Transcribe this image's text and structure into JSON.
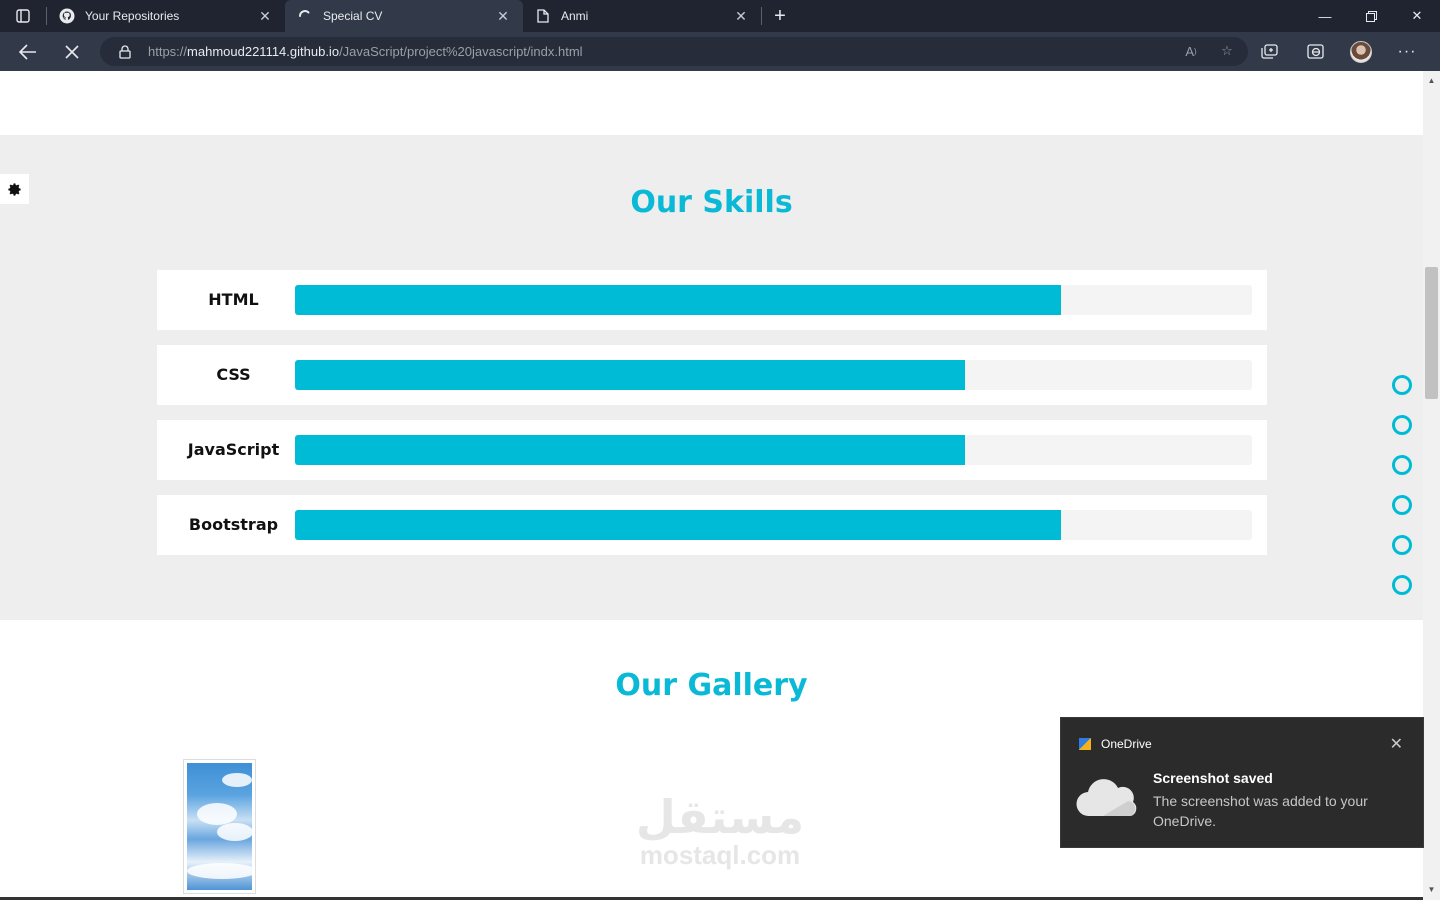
{
  "browser": {
    "tabs": [
      {
        "title": "Your Repositories",
        "icon": "github-icon",
        "active": false
      },
      {
        "title": "Special CV",
        "icon": "loading-spinner-icon",
        "active": true
      },
      {
        "title": "Anmi",
        "icon": "page-icon",
        "active": false
      }
    ],
    "url_prefix": "https://",
    "url_host": "mahmoud221114.github.io",
    "url_path": "/JavaScript/project%20javascript/indx.html"
  },
  "page": {
    "skills_title": "Our Skills",
    "skills": [
      {
        "name": "HTML",
        "percent": 80
      },
      {
        "name": "CSS",
        "percent": 70
      },
      {
        "name": "JavaScript",
        "percent": 70
      },
      {
        "name": "Bootstrap",
        "percent": 80
      }
    ],
    "gallery_title": "Our Gallery",
    "bullets_count": 6,
    "accent_color": "#00bbd5",
    "watermark_ar": "مستقل",
    "watermark_en": "mostaql.com"
  },
  "toast": {
    "app_name": "OneDrive",
    "title": "Screenshot saved",
    "body": "The screenshot was added to your OneDrive."
  }
}
